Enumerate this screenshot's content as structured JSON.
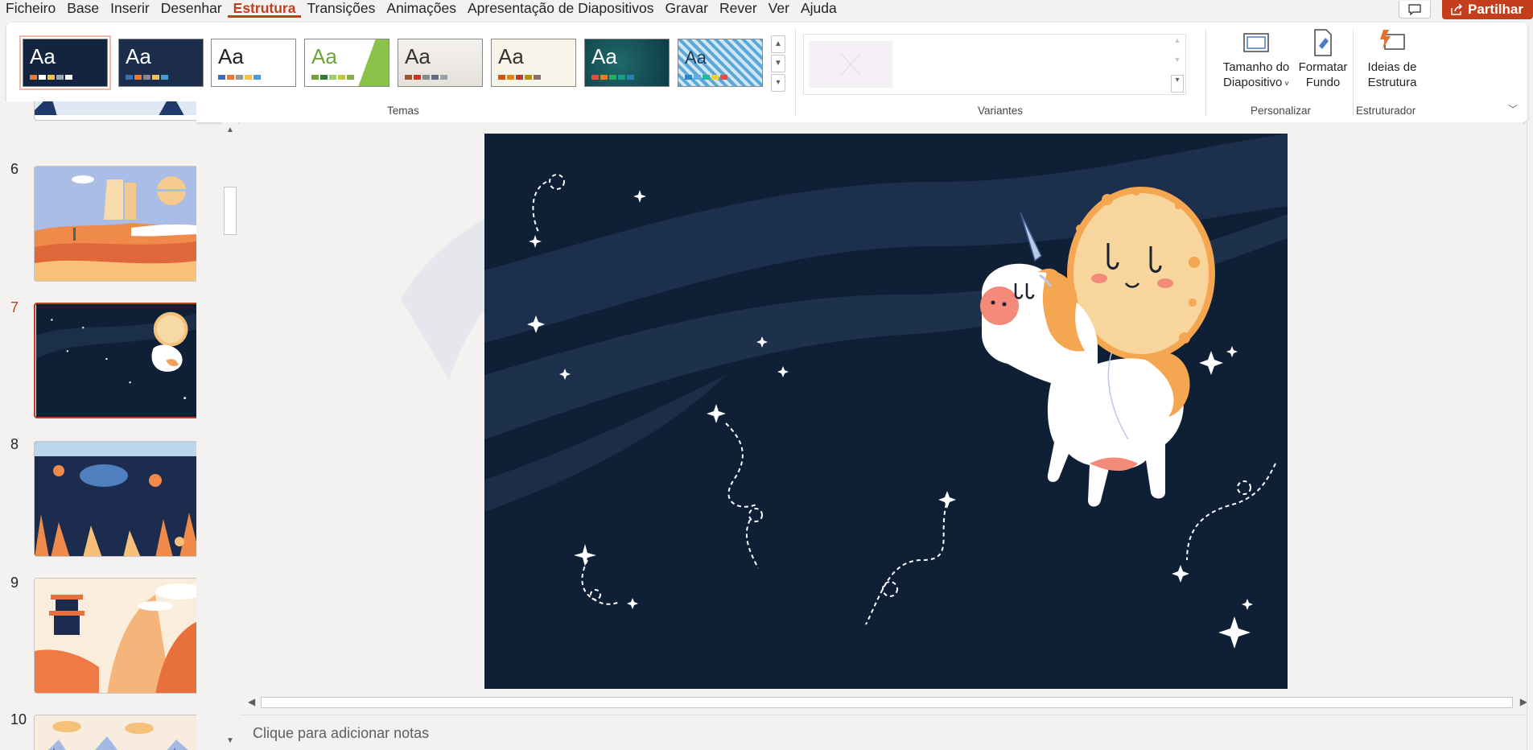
{
  "menu": {
    "items": [
      "Ficheiro",
      "Base",
      "Inserir",
      "Desenhar",
      "Estrutura",
      "Transições",
      "Animações",
      "Apresentação de Diapositivos",
      "Gravar",
      "Rever",
      "Ver",
      "Ajuda"
    ],
    "active": "Estrutura",
    "share_label": "Partilhar"
  },
  "ribbon": {
    "themes_group_label": "Temas",
    "theme_label": "Aa",
    "variants_group_label": "Variantes",
    "customize_group_label": "Personalizar",
    "designer_group_label": "Estruturador",
    "slide_size_label_1": "Tamanho do",
    "slide_size_label_2": "Diapositivo",
    "format_bg_label_1": "Formatar",
    "format_bg_label_2": "Fundo",
    "design_ideas_label_1": "Ideias de",
    "design_ideas_label_2": "Estrutura"
  },
  "slides": {
    "numbers": [
      "6",
      "7",
      "8",
      "9",
      "10"
    ],
    "active": "7"
  },
  "notes": {
    "placeholder": "Clique para adicionar notas"
  },
  "colors": {
    "accent": "#c43e1c",
    "slide_bg": "#0f1f36"
  }
}
